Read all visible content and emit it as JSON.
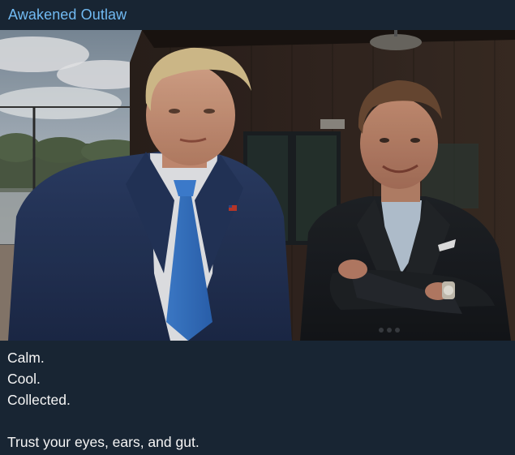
{
  "channel": {
    "name": "Awakened Outlaw"
  },
  "photo": {
    "subject": "two-men-standing-photo"
  },
  "caption": {
    "lines": [
      "Calm.",
      "Cool.",
      "Collected.",
      "",
      "Trust your eyes, ears, and gut."
    ]
  },
  "colors": {
    "background": "#182533",
    "channel_name": "#71baf2",
    "caption_text": "#f5f5f5"
  }
}
